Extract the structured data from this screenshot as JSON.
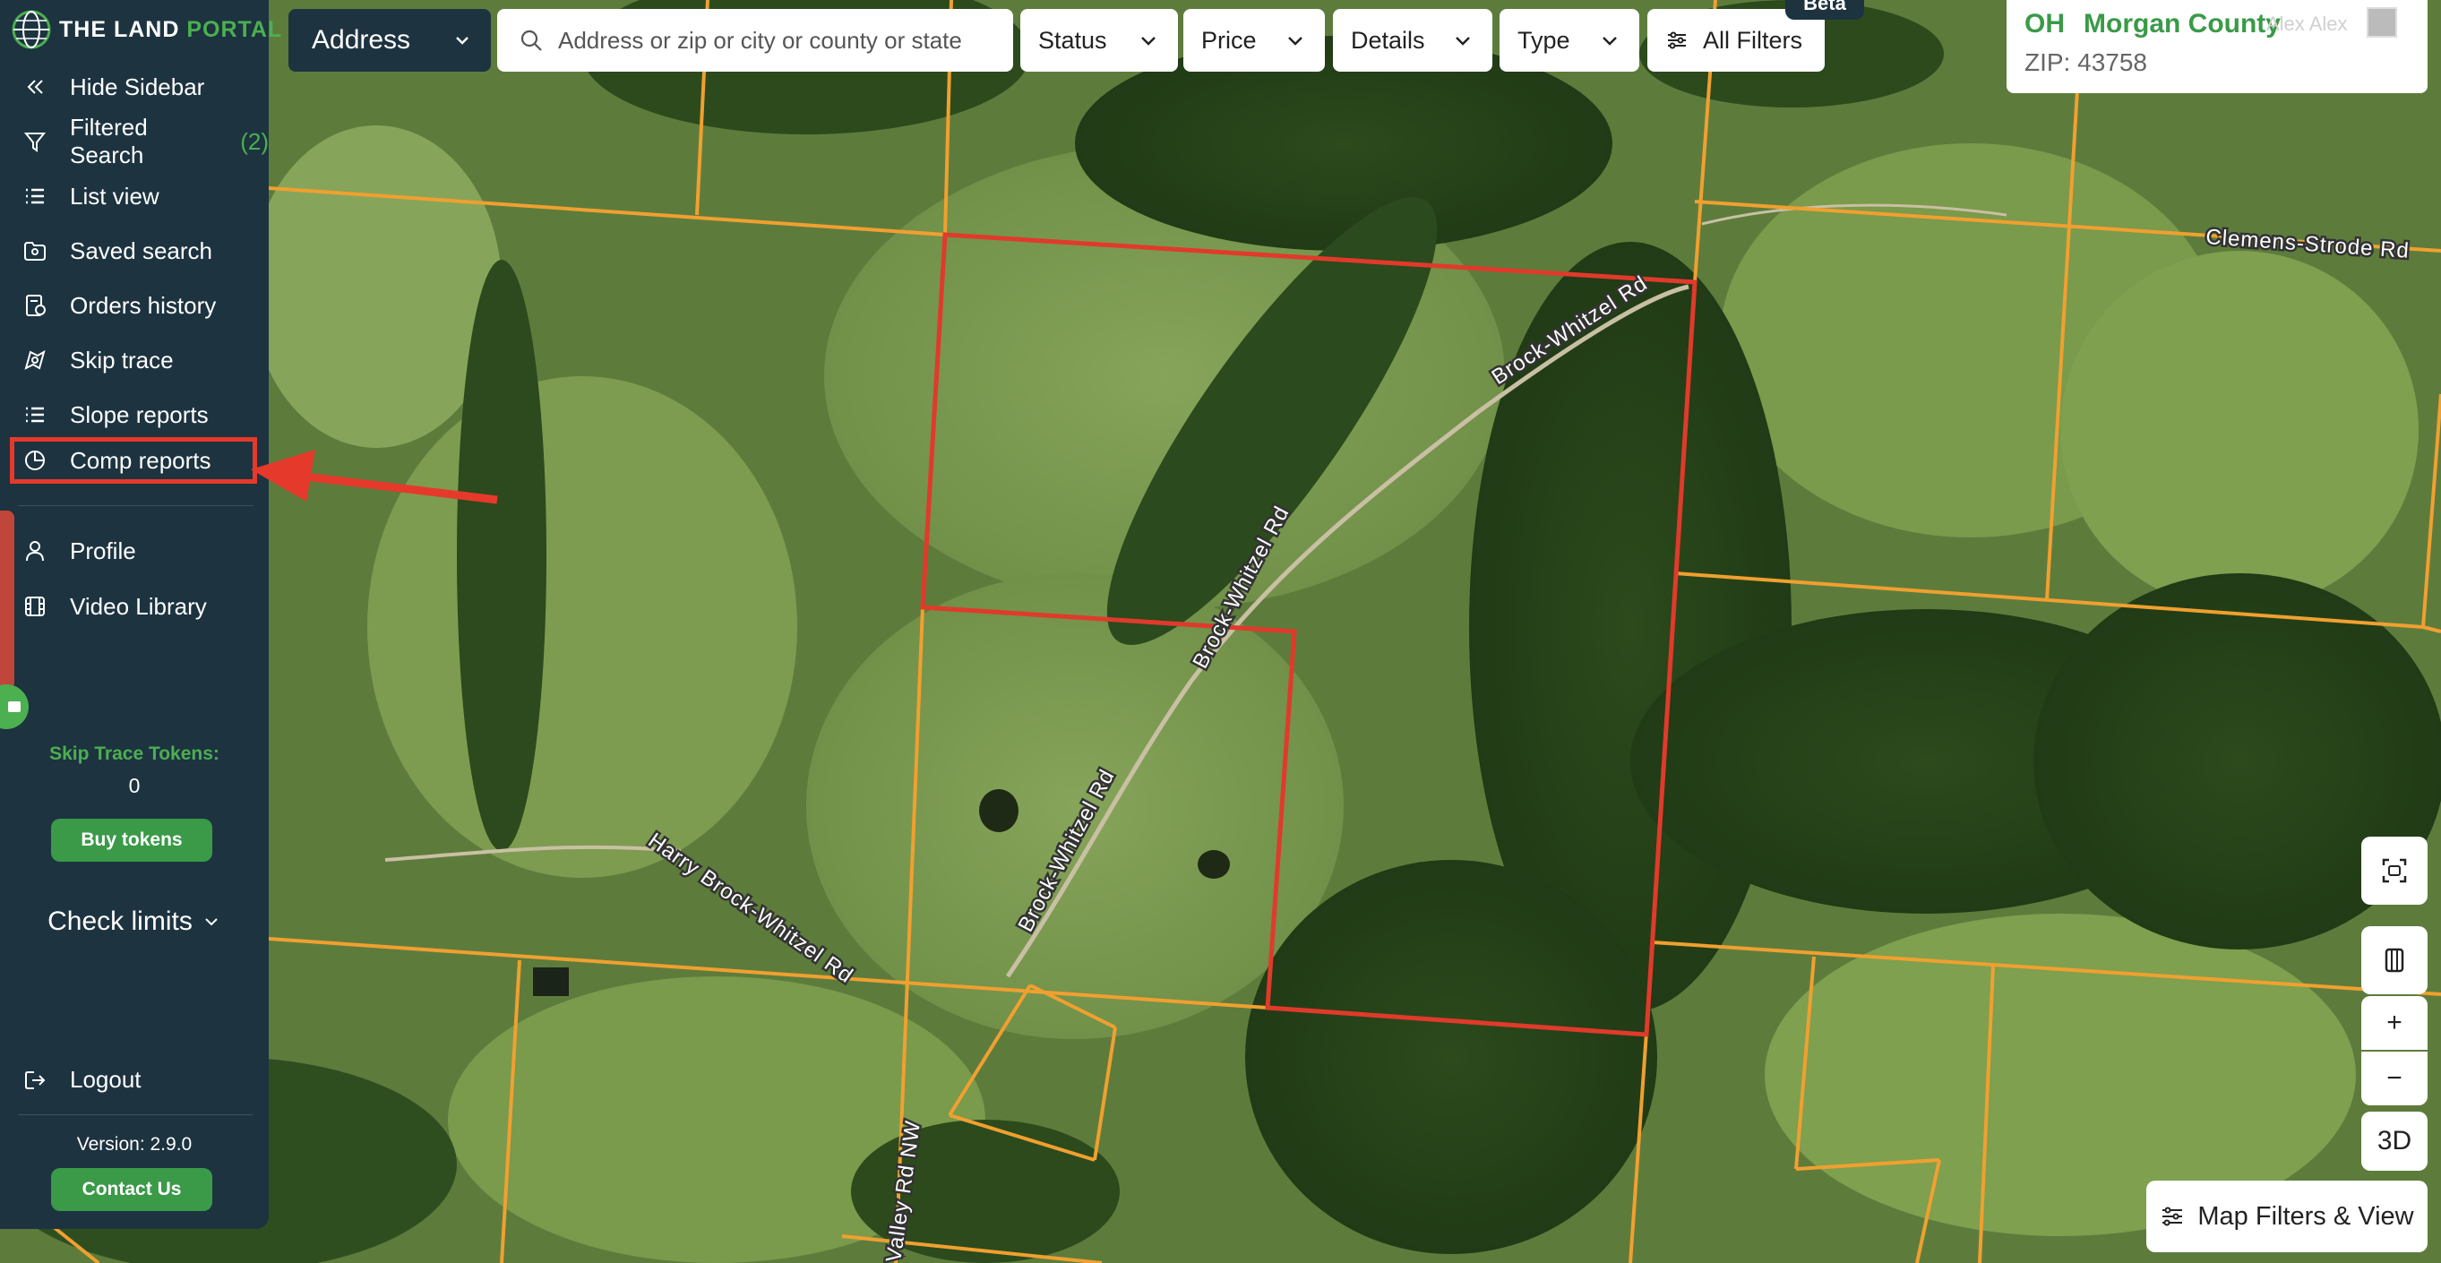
{
  "app": {
    "logo_text_main": "THE LAND ",
    "logo_text_accent": "PORTAL"
  },
  "sidebar": {
    "items": [
      {
        "label": "Hide Sidebar",
        "icon": "chevrons-left-icon"
      },
      {
        "label": "Filtered Search",
        "count": "(2)",
        "icon": "filter-icon"
      },
      {
        "label": "List view",
        "icon": "list-icon"
      },
      {
        "label": "Saved search",
        "icon": "saved-search-icon"
      },
      {
        "label": "Orders history",
        "icon": "orders-icon"
      },
      {
        "label": "Skip trace",
        "icon": "skip-trace-icon"
      },
      {
        "label": "Slope reports",
        "icon": "slope-icon"
      },
      {
        "label": "Comp reports",
        "icon": "pie-chart-icon",
        "highlighted": true
      },
      {
        "label": "Profile",
        "icon": "user-icon"
      },
      {
        "label": "Video Library",
        "icon": "film-icon"
      }
    ],
    "skip_trace_tokens_label": "Skip Trace Tokens:",
    "skip_trace_tokens_value": "0",
    "buy_tokens_label": "Buy tokens",
    "check_limits_label": "Check limits",
    "logout_label": "Logout",
    "version_label": "Version: 2.9.0",
    "contact_label": "Contact Us"
  },
  "topbar": {
    "address_select_label": "Address",
    "search_placeholder": "Address or zip or city or county or state",
    "filters": [
      {
        "label": "Status"
      },
      {
        "label": "Price"
      },
      {
        "label": "Details"
      },
      {
        "label": "Type"
      }
    ],
    "all_filters_label": "All Filters",
    "beta_label": "Beta"
  },
  "location": {
    "state": "OH",
    "county": "Morgan County",
    "user": "Alex Alex",
    "zip": "ZIP: 43758"
  },
  "map": {
    "road_labels": [
      {
        "text": "Brock-Whitzel Rd"
      },
      {
        "text": "Brock-Whitzel Rd"
      },
      {
        "text": "Brock-Whitzel Rd"
      },
      {
        "text": "Harry Brock-Whitzel Rd"
      },
      {
        "text": "Clemens-Strode Rd"
      },
      {
        "text": "Valley Rd NW"
      }
    ],
    "controls": {
      "three_d_label": "3D",
      "zoom_in_label": "+",
      "zoom_out_label": "−"
    },
    "map_filters_label": "Map Filters & View",
    "colors": {
      "parcel_line": "#f0a030",
      "selected_parcel": "#e03a2b"
    }
  }
}
